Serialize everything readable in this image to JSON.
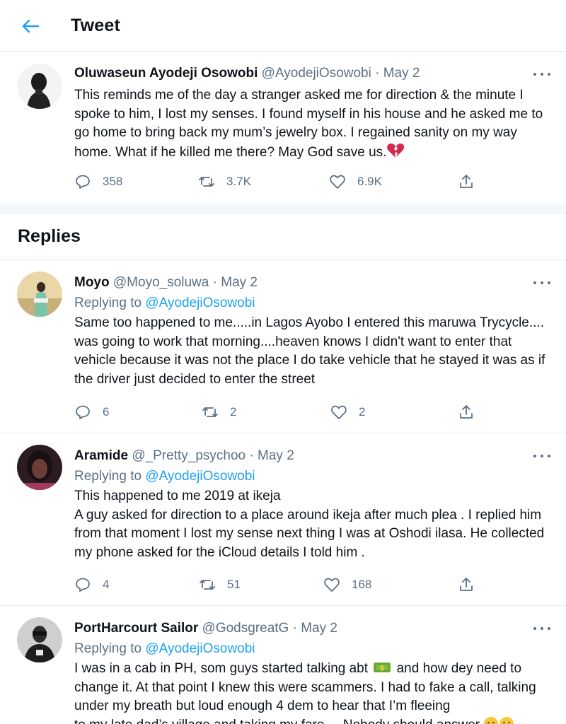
{
  "header": {
    "title": "Tweet"
  },
  "main_tweet": {
    "name": "Oluwaseun Ayodeji Osowobi",
    "handle": "@AyodejiOsowobi",
    "dot": "·",
    "date": "May 2",
    "text": "This reminds me of the day a stranger asked me for direction & the minute I spoke to him, I lost my senses. I found myself in his house and he asked me to go home to bring back my mum’s jewelry box. I regained sanity on my way home. What if he killed me there? May God save us.",
    "emoji": "broken-heart",
    "replies": "358",
    "retweets": "3.7K",
    "likes": "6.9K"
  },
  "replies_heading": "Replies",
  "replies": [
    {
      "name": "Moyo",
      "handle": "@Moyo_soluwa",
      "dot": "·",
      "date": "May 2",
      "replying_prefix": "Replying to",
      "replying_to": "@AyodejiOsowobi",
      "text": "Same too happened to me.....in Lagos Ayobo I entered this maruwa Trycycle.... was going to work that morning....heaven knows I didn't want to enter that vehicle because it was not the place I do take vehicle that he stayed it was as if the driver just decided to enter the street",
      "reply_count": "6",
      "retweet_count": "2",
      "like_count": "2"
    },
    {
      "name": "Aramide",
      "handle": "@_Pretty_psychoo",
      "dot": "·",
      "date": "May 2",
      "replying_prefix": "Replying to",
      "replying_to": "@AyodejiOsowobi",
      "text_line1": "This happened to me 2019 at ikeja",
      "text_line2": "A guy asked for direction to a place around ikeja after much plea . I replied him from that moment I lost my sense next thing I was at Oshodi ilasa. He collected my phone asked for the iCloud details I told him .",
      "reply_count": "4",
      "retweet_count": "51",
      "like_count": "168"
    },
    {
      "name": "PortHarcourt Sailor",
      "handle": "@GodsgreatG",
      "dot": "·",
      "date": "May 2",
      "replying_prefix": "Replying to",
      "replying_to": "@AyodejiOsowobi",
      "text_part1": "I was in a cab in PH, som guys started talking abt",
      "emoji": "dollar-banknote",
      "text_part2": "and how dey need to change it. At that point I knew this were scammers. I had to fake a call, talking under my breath but loud enough 4 dem to hear that I’m fleeing",
      "text_line_cut": "to my late dad’s village and taking my fare ... Nobody should answer",
      "trailing_emoji": "grinning-faces"
    }
  ],
  "colors": {
    "accent": "#1da1f2",
    "muted": "#5b7083",
    "text": "#0f1419",
    "border": "#e6ecf0",
    "broken_heart": "#d6274d",
    "money_green": "#7dbb42"
  },
  "icons": [
    "back-arrow-icon",
    "more-icon",
    "reply-icon",
    "retweet-icon",
    "like-icon",
    "share-icon"
  ]
}
